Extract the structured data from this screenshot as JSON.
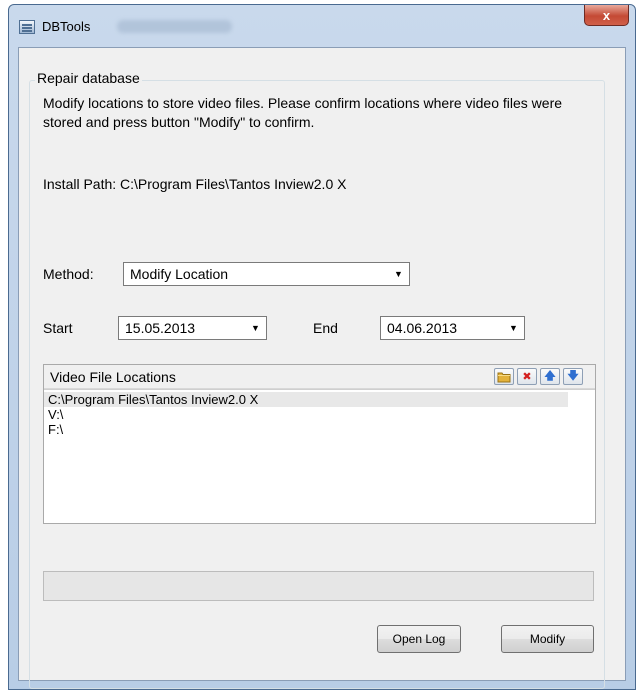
{
  "window": {
    "title": "DBTools",
    "close_label": "x"
  },
  "repair": {
    "group_title": "Repair database",
    "description": "Modify locations to store video files. Please confirm locations where video files were stored and press button \"Modify\" to confirm.",
    "install_path": "Install Path: C:\\Program Files\\Tantos Inview2.0 X"
  },
  "method": {
    "label": "Method:",
    "value": "Modify Location"
  },
  "dates": {
    "start_label": "Start",
    "start_value": "15.05.2013",
    "end_label": "End",
    "end_value": "04.06.2013"
  },
  "locations": {
    "header": "Video File Locations",
    "items": [
      {
        "path": "C:\\Program Files\\Tantos Inview2.0 X"
      },
      {
        "path": "V:\\"
      },
      {
        "path": "F:\\"
      }
    ]
  },
  "buttons": {
    "open_log": "Open Log",
    "modify": "Modify"
  },
  "icons": {
    "app": "database-tool-icon",
    "close": "close-icon",
    "folder": "folder-add-icon",
    "delete": "delete-icon",
    "up": "arrow-up-icon",
    "down": "arrow-down-icon"
  },
  "colors": {
    "close_button": "#c44a35",
    "delete_icon": "#d42020",
    "arrow_icon": "#2f6fd0",
    "folder_icon": "#e3b23c"
  }
}
